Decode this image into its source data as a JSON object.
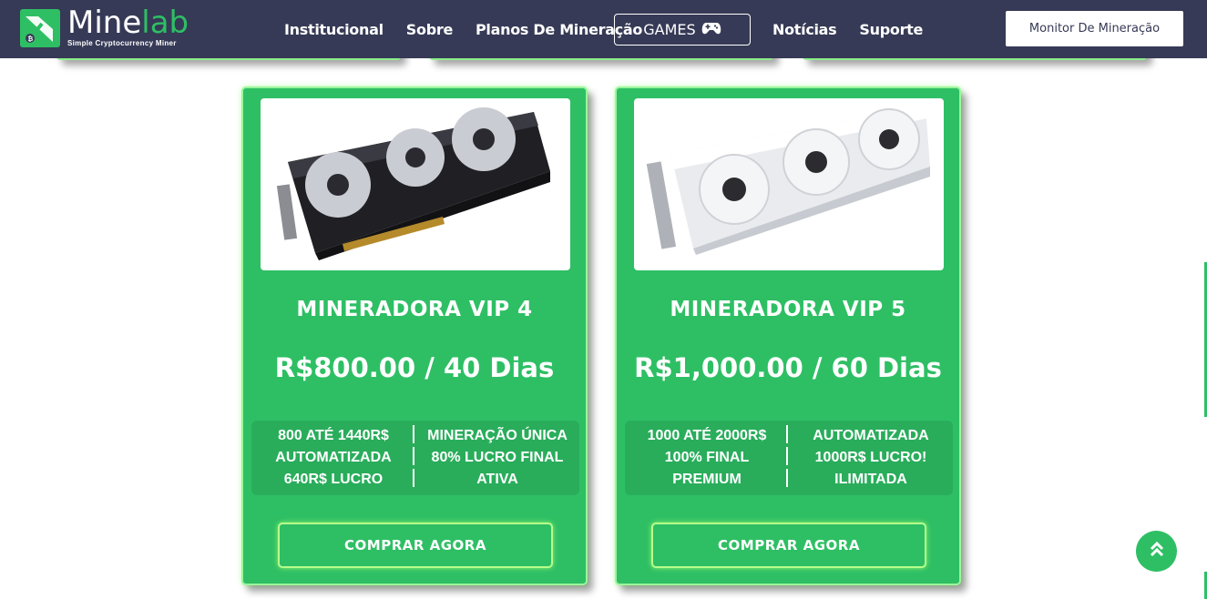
{
  "header": {
    "logo": {
      "name_main": "Mine",
      "name_accent": "lab",
      "tagline": "Simple Cryptocurrency Miner"
    },
    "nav": [
      "Institucional",
      "Sobre",
      "Planos De Mineração"
    ],
    "games_label": "GAMES",
    "nav_right": [
      "Notícias",
      "Suporte"
    ],
    "monitor_label": "Monitor De Mineração"
  },
  "cards": [
    {
      "title": "MINERADORA VIP 4",
      "price": "R$800.00 / 40 Dias",
      "features_left": [
        "800 ATÉ 1440R$",
        "AUTOMATIZADA",
        "640R$ LUCRO"
      ],
      "features_right": [
        "MINERAÇÃO ÚNICA",
        "80% LUCRO FINAL",
        "ATIVA"
      ],
      "button": "COMPRAR AGORA"
    },
    {
      "title": "MINERADORA VIP 5",
      "price": "R$1,000.00 / 60 Dias",
      "features_left": [
        "1000 ATÉ 2000R$",
        "100% FINAL",
        "PREMIUM"
      ],
      "features_right": [
        "AUTOMATIZADA",
        "1000R$ LUCRO!",
        "ILIMITADA"
      ],
      "button": "COMPRAR AGORA"
    }
  ],
  "colors": {
    "header": "#363a56",
    "accent": "#2ebf64",
    "glow": "#9af59a"
  },
  "icons": {
    "logo": "pickaxe-bitcoin-icon",
    "games": "gamepad-icon",
    "scroll_top": "double-chevron-up-icon"
  }
}
